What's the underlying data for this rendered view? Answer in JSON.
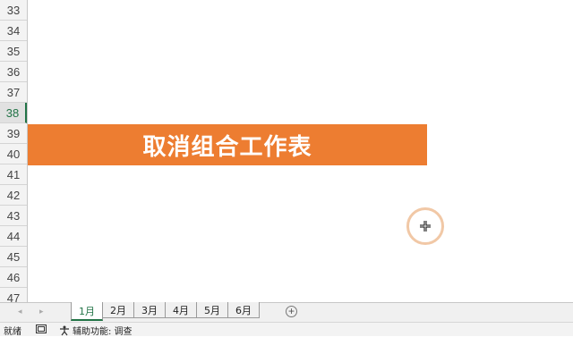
{
  "rows": [
    "33",
    "34",
    "35",
    "36",
    "37",
    "38",
    "39",
    "40",
    "41",
    "42",
    "43",
    "44",
    "45",
    "46",
    "47"
  ],
  "selected_row": "38",
  "banner": {
    "text": "取消组合工作表",
    "color": "#ED7D31"
  },
  "sheet_tabs": [
    "1月",
    "2月",
    "3月",
    "4月",
    "5月",
    "6月"
  ],
  "active_tab": "1月",
  "icons": {
    "nav_prev": "◂",
    "nav_next": "▸",
    "add_sheet": "+",
    "cursor": "move-cross-icon"
  },
  "status": {
    "ready": "就绪",
    "accessibility": "辅助功能: 调查"
  },
  "colors": {
    "accent": "#217346",
    "banner": "#ED7D31",
    "cursor_ring": "#F1C8A6"
  }
}
